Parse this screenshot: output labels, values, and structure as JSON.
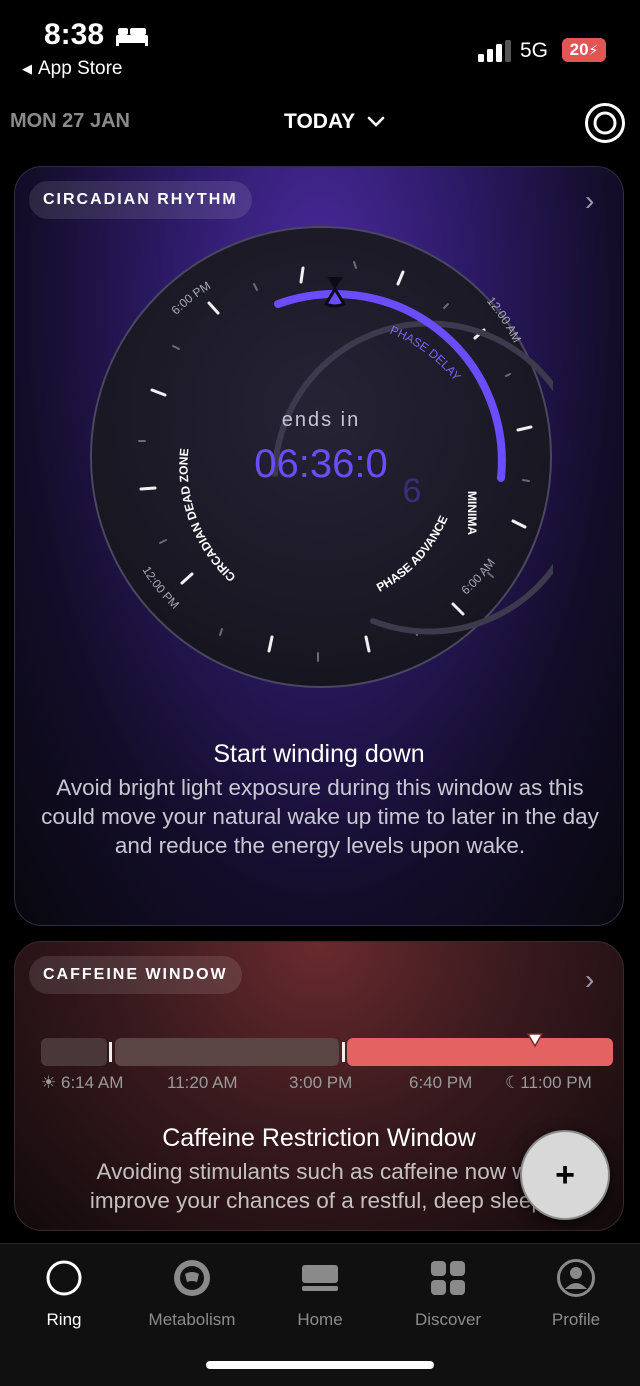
{
  "status": {
    "time": "8:38",
    "back_label": "App Store",
    "network": "5G",
    "battery": "20"
  },
  "datebar": {
    "prev_date": "MON 27 JAN",
    "current": "TODAY"
  },
  "circadian": {
    "pill": "CIRCADIAN RHYTHM",
    "ends_in_label": "ends in",
    "countdown_main": "06:36:0",
    "countdown_last": "6",
    "clock_labels": [
      "6:00 PM",
      "12:00 AM",
      "6:00 AM",
      "12:00 PM"
    ],
    "zone_labels": [
      "PHASE DELAY",
      "MINIMA",
      "PHASE ADVANCE",
      "CIRCADIAN DEAD ZONE"
    ],
    "accent_color": "#6b4dff",
    "title": "Start winding down",
    "body": "Avoid bright light exposure during this window as this could move your natural wake up time to later in the day and reduce the energy levels upon wake."
  },
  "caffeine": {
    "pill": "CAFFEINE WINDOW",
    "times": [
      "6:14 AM",
      "11:20 AM",
      "3:00 PM",
      "6:40 PM",
      "11:00 PM"
    ],
    "sun_icon": "☀",
    "moon_icon": "☾",
    "restriction_color": "#e56262",
    "title": "Caffeine Restriction Window",
    "body": "Avoiding stimulants such as caffeine now will improve your chances of a restful, deep sleep."
  },
  "fab_label": "+",
  "tabs": [
    {
      "label": "Ring",
      "icon": "ring-icon"
    },
    {
      "label": "Metabolism",
      "icon": "metabolism-icon"
    },
    {
      "label": "Home",
      "icon": "home-icon"
    },
    {
      "label": "Discover",
      "icon": "discover-icon"
    },
    {
      "label": "Profile",
      "icon": "profile-icon"
    }
  ]
}
